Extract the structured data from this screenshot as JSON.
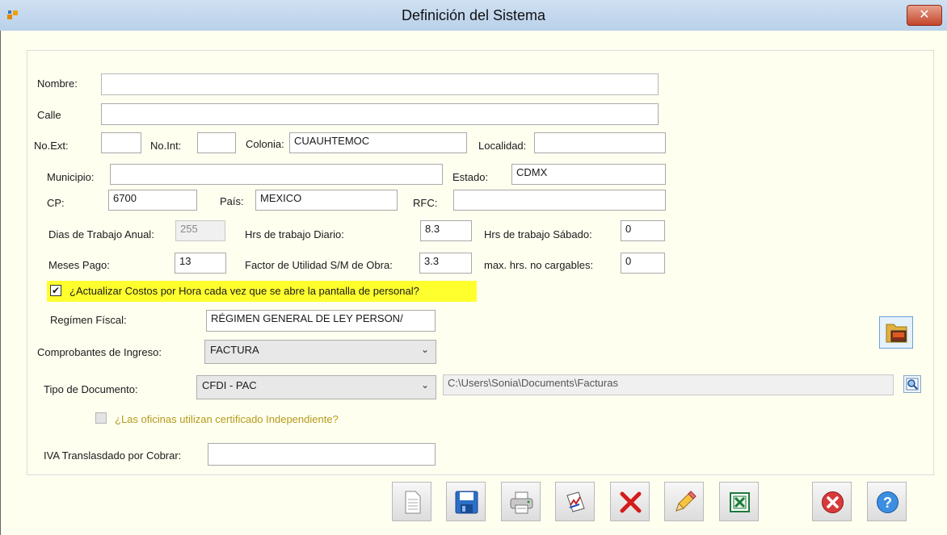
{
  "window": {
    "title": "Definición del Sistema",
    "close": "✕"
  },
  "form": {
    "nombre": {
      "label": "Nombre:",
      "value": ""
    },
    "calle": {
      "label": "Calle",
      "value": ""
    },
    "no_ext": {
      "label": "No.Ext:",
      "value": ""
    },
    "no_int": {
      "label": "No.Int:",
      "value": ""
    },
    "colonia": {
      "label": "Colonia:",
      "value": "CUAUHTEMOC"
    },
    "localidad": {
      "label": "Localidad:",
      "value": ""
    },
    "municipio": {
      "label": "Municipio:",
      "value": ""
    },
    "estado": {
      "label": "Estado:",
      "value": "CDMX"
    },
    "cp": {
      "label": "CP:",
      "value": "6700"
    },
    "pais": {
      "label": "País:",
      "value": "MEXICO"
    },
    "rfc": {
      "label": "RFC:",
      "value": ""
    },
    "dias_trabajo": {
      "label": "Dias de Trabajo Anual:",
      "value": "255"
    },
    "hrs_diario": {
      "label": "Hrs de trabajo Diario:",
      "value": "8.3"
    },
    "hrs_sabado": {
      "label": "Hrs de trabajo Sábado:",
      "value": "0"
    },
    "meses_pago": {
      "label": "Meses Pago:",
      "value": "13"
    },
    "factor_utilidad": {
      "label": "Factor de Utilidad S/M de Obra:",
      "value": "3.3"
    },
    "max_hrs": {
      "label": "max. hrs. no cargables:",
      "value": "0"
    },
    "actualizar_costos": {
      "label": "¿Actualizar Costos por Hora cada vez que se abre la pantalla de personal?",
      "checked": true,
      "mark": "✔"
    },
    "regimen": {
      "label": "Regímen Físcal:",
      "value": "RÉGIMEN GENERAL DE LEY PERSON/"
    },
    "comprobantes": {
      "label": "Comprobantes de Ingreso:",
      "value": "FACTURA"
    },
    "tipo_documento": {
      "label": "Tipo de Documento:",
      "value": "CFDI - PAC"
    },
    "ruta": {
      "value": "C:\\Users\\Sonia\\Documents\\Facturas"
    },
    "oficinas_cert": {
      "label": "¿Las oficinas utilizan certificado Independiente?",
      "checked": false
    },
    "iva": {
      "label": "IVA Translasdado por Cobrar:",
      "value": ""
    }
  },
  "colors": {
    "highlight": "#ffff2e",
    "background": "#fffff0",
    "title_bar": "#c5daf0",
    "close": "#c3462b"
  },
  "toolbar": {
    "icons": [
      "new-document-icon",
      "save-icon",
      "print-icon",
      "report-icon",
      "delete-icon",
      "edit-icon",
      "excel-icon",
      "cancel-icon",
      "help-icon"
    ],
    "help_glyph": "?"
  }
}
